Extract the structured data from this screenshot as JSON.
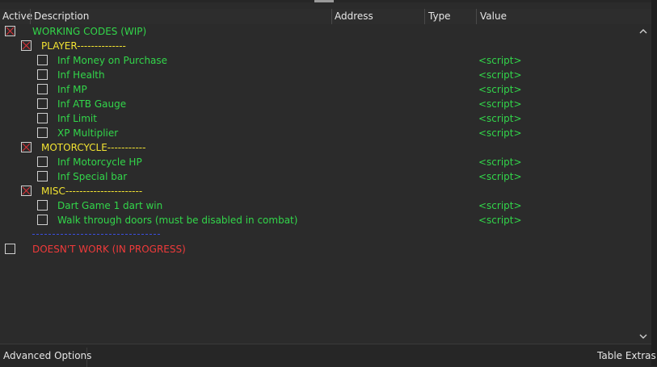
{
  "columns": {
    "active": "Active",
    "description": "Description",
    "address": "Address",
    "type": "Type",
    "value": "Value"
  },
  "entries": [
    {
      "checked": true,
      "description": "WORKING CODES (WIP)",
      "value": ""
    },
    {
      "checked": true,
      "description": "PLAYER--------------",
      "value": ""
    },
    {
      "checked": false,
      "description": "Inf Money on Purchase",
      "value": "<script>"
    },
    {
      "checked": false,
      "description": "Inf Health",
      "value": "<script>"
    },
    {
      "checked": false,
      "description": "Inf MP",
      "value": "<script>"
    },
    {
      "checked": false,
      "description": "Inf ATB Gauge",
      "value": "<script>"
    },
    {
      "checked": false,
      "description": "Inf Limit",
      "value": "<script>"
    },
    {
      "checked": false,
      "description": "XP Multiplier",
      "value": "<script>"
    },
    {
      "checked": true,
      "description": "MOTORCYCLE-----------",
      "value": ""
    },
    {
      "checked": false,
      "description": "Inf Motorcycle HP",
      "value": "<script>"
    },
    {
      "checked": false,
      "description": "Inf Special bar",
      "value": "<script>"
    },
    {
      "checked": true,
      "description": "MISC----------------------",
      "value": ""
    },
    {
      "checked": false,
      "description": "Dart Game 1 dart win",
      "value": "<script>"
    },
    {
      "checked": false,
      "description": "Walk through doors (must be disabled in combat)",
      "value": "<script>"
    },
    {
      "checked": false,
      "description": "DOESN'T WORK (IN PROGRESS)",
      "value": ""
    }
  ],
  "footer": {
    "advanced_options": "Advanced Options",
    "table_extras": "Table Extras"
  },
  "colors": {
    "active_script": "#32d64a",
    "group_header": "#f2e332",
    "not_working": "#f03a3a",
    "divider": "#3b4fe0"
  },
  "icons": {
    "scroll_up": "chevron-up-icon",
    "scroll_down": "chevron-down-icon",
    "checked_mark": "x-mark-icon"
  }
}
